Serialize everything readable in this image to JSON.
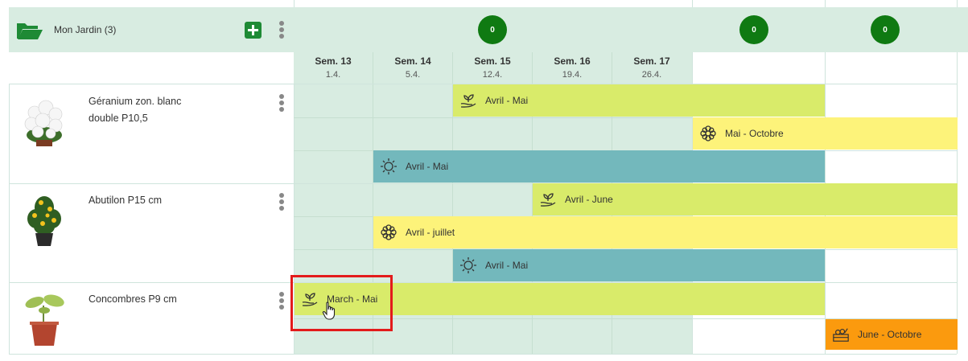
{
  "garden": {
    "title": "Mon Jardin (3)",
    "counts": [
      "0",
      "0",
      "0"
    ]
  },
  "weeks": [
    {
      "label": "Sem. 13",
      "date": "1.4."
    },
    {
      "label": "Sem. 14",
      "date": "5.4."
    },
    {
      "label": "Sem. 15",
      "date": "12.4."
    },
    {
      "label": "Sem. 16",
      "date": "19.4."
    },
    {
      "label": "Sem. 17",
      "date": "26.4."
    }
  ],
  "plants": [
    {
      "name": "Géranium zon. blanc double P10,5"
    },
    {
      "name": "Abutilon P15 cm"
    },
    {
      "name": "Concombres P9 cm"
    }
  ],
  "bars": {
    "geranium_sow": "Avril - Mai",
    "geranium_bloom": "Mai - Octobre",
    "geranium_sun": "Avril - Mai",
    "abutilon_sow": "Avril - June",
    "abutilon_bloom": "Avril - juillet",
    "abutilon_sun": "Avril - Mai",
    "concombres_sow": "March - Mai",
    "concombres_harvest": "June - Octobre"
  },
  "colors": {
    "header_bg": "#d8ece1",
    "badge": "#0f7a12",
    "add_button": "#1e8a35",
    "bar_green": "#d9eb6a",
    "bar_yellow": "#fdf37a",
    "bar_teal": "#73b8bc",
    "bar_orange": "#fb9a0e",
    "highlight": "#e31b1b"
  }
}
